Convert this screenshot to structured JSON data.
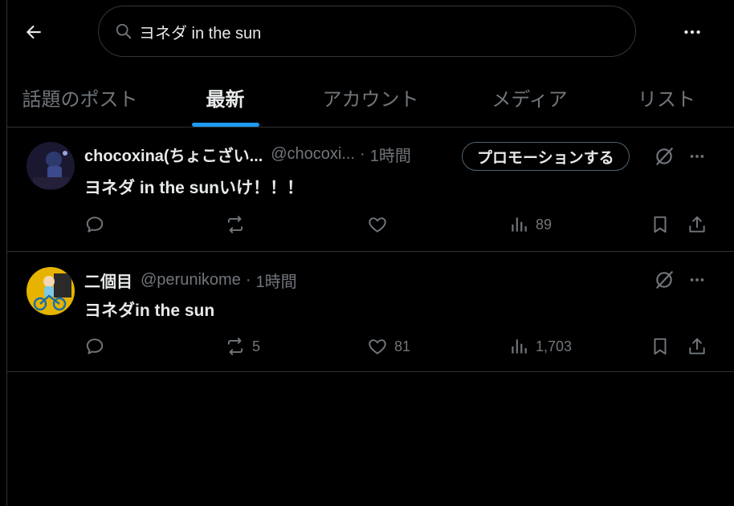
{
  "search": {
    "query": "ヨネダ in the sun"
  },
  "tabs": [
    {
      "label": "話題のポスト",
      "active": false
    },
    {
      "label": "最新",
      "active": true
    },
    {
      "label": "アカウント",
      "active": false
    },
    {
      "label": "メディア",
      "active": false
    },
    {
      "label": "リスト",
      "active": false
    }
  ],
  "posts": [
    {
      "name": "chocoxina(ちょこざい...",
      "handle": "@chocoxi...",
      "dot": "·",
      "time": "1時間",
      "promo_label": "プロモーションする",
      "text": "ヨネダ in the sunいけ！！！",
      "replies": "",
      "reposts": "",
      "likes": "",
      "views": "89"
    },
    {
      "name": "二個目",
      "handle": "@perunikome",
      "dot": "·",
      "time": "1時間",
      "text": "ヨネダin the sun",
      "replies": "",
      "reposts": "5",
      "likes": "81",
      "views": "1,703"
    }
  ],
  "colors": {
    "background": "#000000",
    "text": "#e7e9ea",
    "muted": "#71767b",
    "accent": "#1d9bf0",
    "border": "#2f3336"
  }
}
